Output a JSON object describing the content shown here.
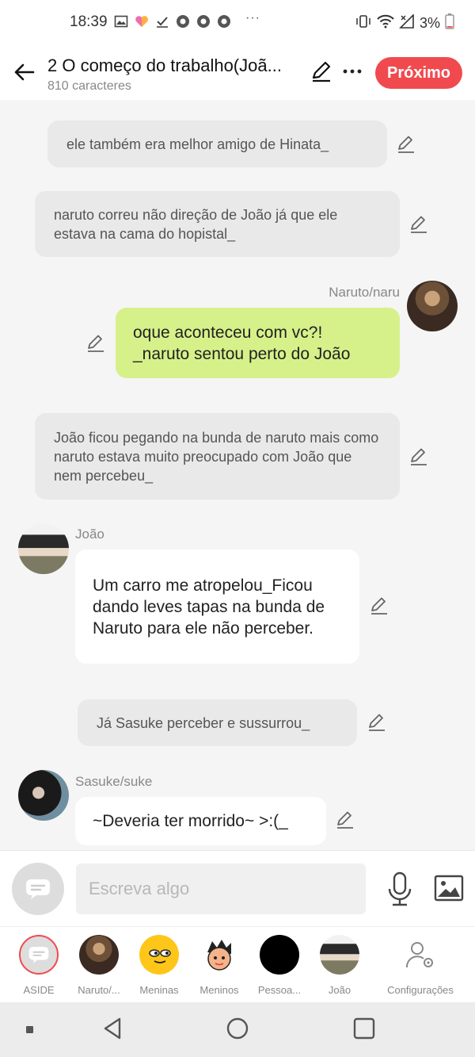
{
  "status_bar": {
    "time": "18:39",
    "dots": "···",
    "battery": "3%"
  },
  "header": {
    "title": "2 O começo do trabalho(Joã...",
    "subtitle": "810 caracteres",
    "next_label": "Próximo"
  },
  "messages": [
    {
      "type": "narration",
      "text": "ele também era melhor amigo de Hinata_"
    },
    {
      "type": "narration",
      "text": "naruto correu não direção de João já que ele estava na cama do hopistal_"
    },
    {
      "type": "dialogue",
      "speaker": "Naruto/naru",
      "side": "right",
      "text": "oque aconteceu com vc?!\n_naruto sentou perto do João"
    },
    {
      "type": "narration",
      "text": "João ficou pegando na bunda de naruto mais como naruto estava muito preocupado com João que nem percebeu_"
    },
    {
      "type": "dialogue",
      "speaker": "João",
      "side": "left",
      "text": "Um carro me atropelou_Ficou dando leves tapas na bunda de Naruto para ele não perceber."
    },
    {
      "type": "narration",
      "text": "Já Sasuke perceber e sussurrou_"
    },
    {
      "type": "dialogue",
      "speaker": "Sasuke/suke",
      "side": "left",
      "text": "~Deveria ter morrido~ >:(_"
    }
  ],
  "input": {
    "placeholder": "Escreva algo"
  },
  "characters": [
    {
      "label": "ASIDE",
      "icon": "aside-icon"
    },
    {
      "label": "Naruto/...",
      "icon": "naruto-avatar"
    },
    {
      "label": "Meninas",
      "icon": "meninas-avatar"
    },
    {
      "label": "Meninos",
      "icon": "meninos-avatar"
    },
    {
      "label": "Pessoa...",
      "icon": "pessoa-avatar"
    },
    {
      "label": "João",
      "icon": "joao-avatar"
    },
    {
      "label": "Configurações",
      "icon": "settings-icon"
    }
  ],
  "colors": {
    "accent": "#f04a4f",
    "green_bubble": "#d6f18a",
    "narration_bg": "#e9e9e9"
  }
}
